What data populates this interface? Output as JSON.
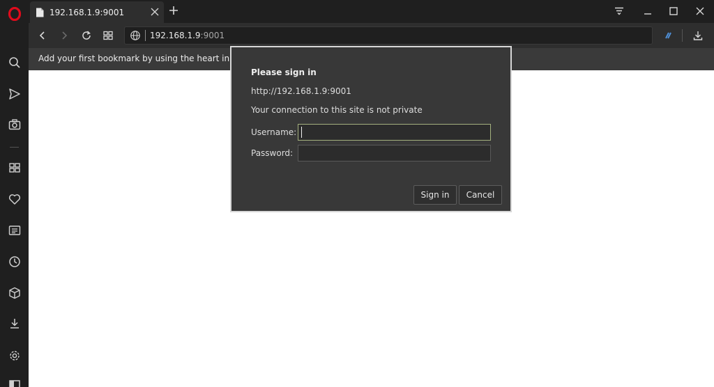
{
  "browser": {
    "tab": {
      "title": "192.168.1.9:9001"
    },
    "address": {
      "host": "192.168.1.9",
      "port": ":9001"
    },
    "bookmarks_hint": "Add your first bookmark by using the heart in the"
  },
  "dialog": {
    "title": "Please sign in",
    "url": "http://192.168.1.9:9001",
    "warning": "Your connection to this site is not private",
    "username_label": "Username:",
    "username_value": "",
    "password_label": "Password:",
    "password_value": "",
    "sign_in_label": "Sign in",
    "cancel_label": "Cancel"
  },
  "colors": {
    "accent": "#e00b1c",
    "sidebar_bg": "#1f1f1f",
    "focus_border": "#a5b17f"
  },
  "icons": {
    "sidebar": [
      "opera-logo-icon",
      "search-icon",
      "send-icon",
      "camera-icon",
      "speed-dial-icon",
      "heart-icon",
      "news-icon",
      "history-icon",
      "cube-icon",
      "download-icon",
      "settings-icon",
      "sidebar-toggle-icon"
    ],
    "toolbar": [
      "back-icon",
      "forward-icon",
      "reload-icon",
      "tab-grid-icon",
      "globe-icon",
      "vpn-icon",
      "download-icon"
    ]
  }
}
